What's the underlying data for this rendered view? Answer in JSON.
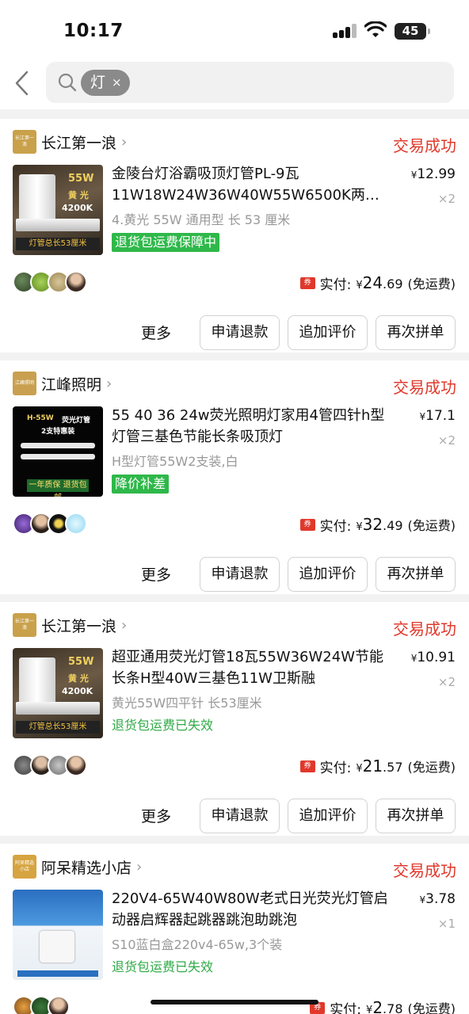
{
  "status_bar": {
    "time": "10:17",
    "battery": "45"
  },
  "search": {
    "chip_text": "灯",
    "chip_close": "×"
  },
  "orders": [
    {
      "shop_logo_text": "长江第一浪",
      "shop_name": "长江第一浪",
      "status": "交易成功",
      "thumb_power": "55W",
      "thumb_color_label": "黄 光",
      "thumb_temp": "4200K",
      "thumb_banner": "灯管总长53厘米",
      "title": "金陵台灯浴霸吸顶灯管PL-9瓦11W18W24W36W40W55W6500K两…",
      "spec": "4.黄光 55W 通用型 长 53 厘米",
      "tag": "退货包运费保障中",
      "tag_style": "solid",
      "unit_price": "12.99",
      "quantity": "×2",
      "paid_label": "实付:",
      "paid_int": "24",
      "paid_dec": ".69",
      "shipping": "(免运费)"
    },
    {
      "shop_logo_text": "江峰照明",
      "shop_name": "江峰照明",
      "status": "交易成功",
      "thumb_power": "H-55W",
      "thumb_color_label": "荧光灯管",
      "thumb_temp": "2支特惠装",
      "thumb_banner": "一年质保 退货包邮",
      "title": "55 40 36 24w荧光照明灯家用4管四针h型灯管三基色节能长条吸顶灯",
      "spec": "H型灯管55W2支装,白",
      "tag": "降价补差",
      "tag_style": "solid",
      "unit_price": "17.1",
      "quantity": "×2",
      "paid_label": "实付:",
      "paid_int": "32",
      "paid_dec": ".49",
      "shipping": "(免运费)"
    },
    {
      "shop_logo_text": "长江第一浪",
      "shop_name": "长江第一浪",
      "status": "交易成功",
      "thumb_power": "55W",
      "thumb_color_label": "黄 光",
      "thumb_temp": "4200K",
      "thumb_banner": "灯管总长53厘米",
      "title": "超亚通用荧光灯管18瓦55W36W24W节能长条H型40W三基色11W卫斯融",
      "spec": "黄光55W四平针 长53厘米",
      "tag": "退货包运费已失效",
      "tag_style": "plain",
      "unit_price": "10.91",
      "quantity": "×2",
      "paid_label": "实付:",
      "paid_int": "21",
      "paid_dec": ".57",
      "shipping": "(免运费)"
    },
    {
      "shop_logo_text": "阿呆精选小店",
      "shop_name": "阿呆精选小店",
      "status": "交易成功",
      "title": "220V4-65W40W80W老式日光荧光灯管启动器启辉器起跳器跳泡助跳泡",
      "spec": "S10蓝白盒220v4-65w,3个装",
      "tag": "退货包运费已失效",
      "tag_style": "plain",
      "unit_price": "3.78",
      "quantity": "×1",
      "paid_label": "实付:",
      "paid_int": "2",
      "paid_dec": ".78",
      "shipping": "(免运费)"
    }
  ],
  "actions": {
    "more": "更多",
    "refund": "申请退款",
    "add_review": "追加评价",
    "rebuy": "再次拼单"
  },
  "coupon_icon": "券",
  "currency": "¥"
}
